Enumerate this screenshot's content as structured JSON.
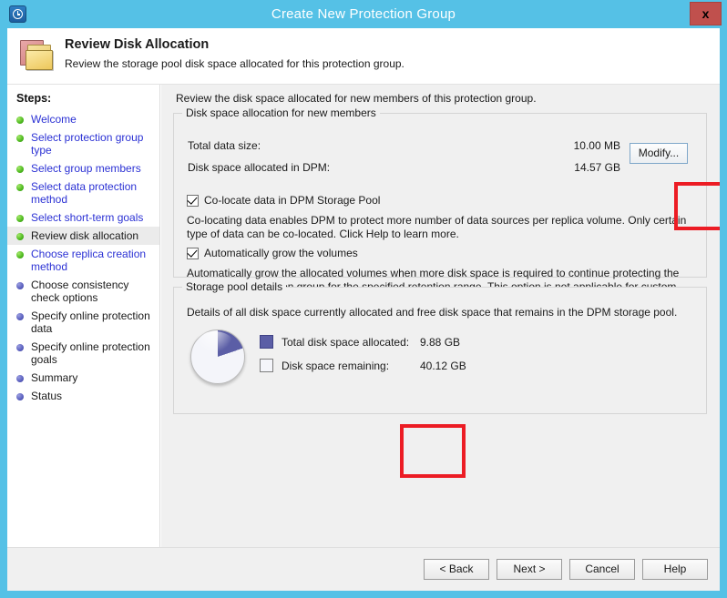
{
  "window": {
    "title": "Create New Protection Group",
    "app_icon": "recovery-clock-icon",
    "close_label": "x"
  },
  "header": {
    "icon": "folders-icon",
    "title": "Review Disk Allocation",
    "subtitle": "Review the storage pool disk space allocated for this protection group."
  },
  "sidebar": {
    "heading": "Steps:",
    "items": [
      {
        "label": "Welcome",
        "state": "done"
      },
      {
        "label": "Select protection group type",
        "state": "done"
      },
      {
        "label": "Select group members",
        "state": "done"
      },
      {
        "label": "Select data protection method",
        "state": "done"
      },
      {
        "label": "Select short-term goals",
        "state": "done"
      },
      {
        "label": "Review disk allocation",
        "state": "current"
      },
      {
        "label": "Choose replica creation method",
        "state": "done"
      },
      {
        "label": "Choose consistency check options",
        "state": "pending"
      },
      {
        "label": "Specify online protection data",
        "state": "pending"
      },
      {
        "label": "Specify online protection goals",
        "state": "pending"
      },
      {
        "label": "Summary",
        "state": "pending"
      },
      {
        "label": "Status",
        "state": "pending"
      }
    ]
  },
  "content": {
    "intro": "Review the disk space allocated for new members of this protection group.",
    "allocation": {
      "legend": "Disk space allocation for new members",
      "total_data_size_label": "Total data size:",
      "total_data_size_value": "10.00 MB",
      "allocated_label": "Disk space allocated in DPM:",
      "allocated_value": "14.57 GB",
      "modify_label": "Modify...",
      "colocate_label": "Co-locate data in DPM Storage Pool",
      "colocate_desc": "Co-locating data enables DPM to protect more number of data sources per replica volume. Only certain type of data can be co-located. Click Help to learn more.",
      "autogrow_label": "Automatically grow the volumes",
      "autogrow_desc": "Automatically grow the allocated volumes when more disk space is required to continue protecting the items in the protection group for the specified retention range. This option is not applicable for custom volumes."
    },
    "storage": {
      "legend": "Storage pool details",
      "desc": "Details of all disk space currently allocated and free disk space that remains in the DPM storage pool.",
      "allocated_label": "Total disk space allocated:",
      "allocated_value": "9.88 GB",
      "remaining_label": "Disk space remaining:",
      "remaining_value": "40.12 GB"
    }
  },
  "chart_data": {
    "type": "pie",
    "title": "Storage pool details",
    "labels": [
      "Total disk space allocated",
      "Disk space remaining"
    ],
    "values": [
      9.88,
      40.12
    ],
    "value_labels": [
      "9.88 GB",
      "40.12 GB"
    ],
    "unit": "GB",
    "total": 50.0,
    "percentages": [
      19.8,
      80.2
    ],
    "colors": [
      "#5b5ea6",
      "#f4f5fa"
    ],
    "legend_position": "right",
    "start_angle_deg": 0,
    "direction": "clockwise"
  },
  "annotations": {
    "allocation_box_color": "#ec1c24",
    "pool_box_color": "#ec1c24"
  },
  "footer": {
    "back": "< Back",
    "next": "Next >",
    "cancel": "Cancel",
    "help": "Help"
  }
}
